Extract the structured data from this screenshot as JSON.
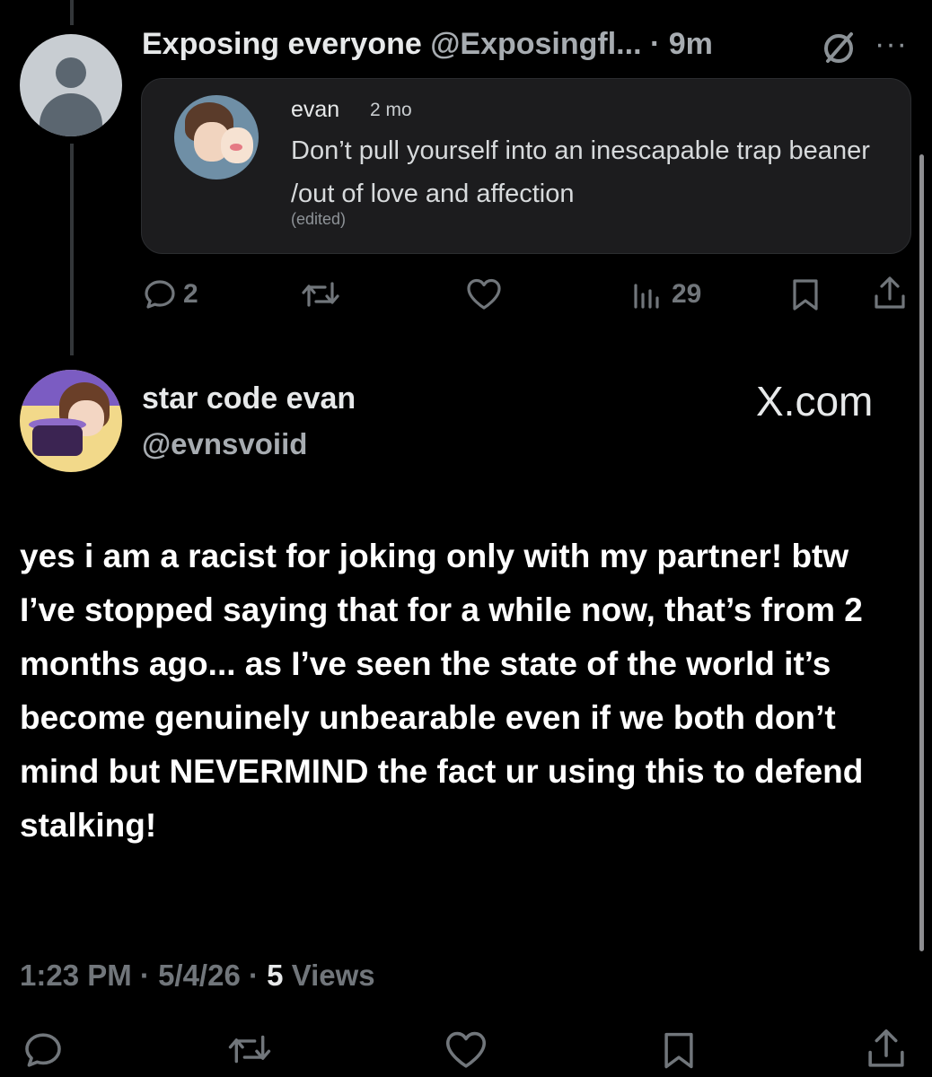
{
  "post": {
    "author_name": "Exposing everyone",
    "author_handle": "@Exposingfl...",
    "time": "· 9m",
    "more": "···"
  },
  "quote": {
    "name": "evan",
    "time": "2 mo",
    "text": "Don’t pull yourself into an inescapable trap beaner /out of love and affection",
    "edited": "(edited)"
  },
  "post_actions": {
    "replies": "2",
    "views": "29"
  },
  "reply": {
    "author_name": "star code evan",
    "author_handle": "@evnsvoiid",
    "watermark": "X.com",
    "body": "yes i am a racist for joking only with my partner! btw I’ve stopped saying that for a while now, that’s from 2 months ago... as I’ve seen the state of the world it’s become genuinely unbearable even if we both don’t mind but NEVERMIND the fact ur using this to defend stalking!",
    "time": "1:23 PM",
    "date": "5/4/26",
    "views_count": "5",
    "views_label": "Views"
  },
  "colors": {
    "background": "#000000",
    "text": "#e7e9ea",
    "muted": "#71767b",
    "card": "#1c1c1e"
  },
  "icons": [
    "muted-icon",
    "more-icon",
    "reply-icon",
    "repost-icon",
    "like-icon",
    "views-icon",
    "bookmark-icon",
    "share-icon"
  ]
}
